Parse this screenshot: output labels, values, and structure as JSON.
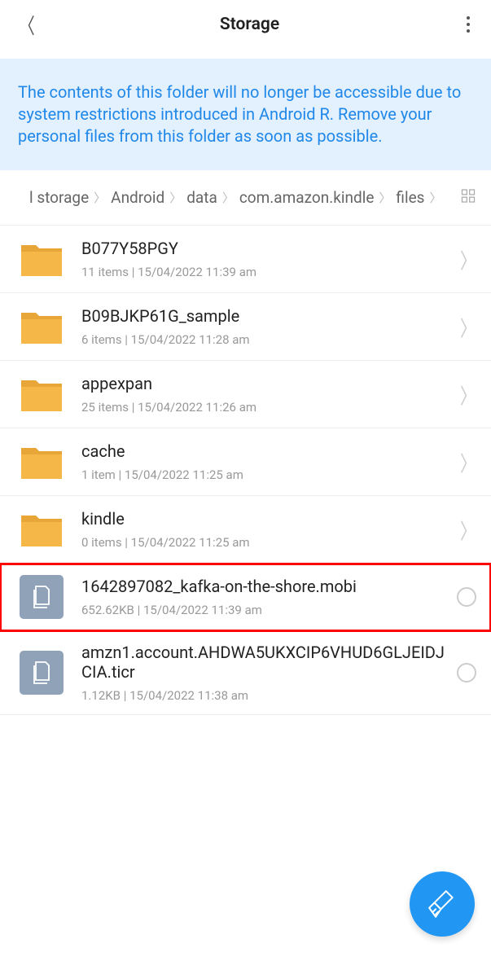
{
  "header": {
    "title": "Storage"
  },
  "banner": {
    "text": "The contents of this folder will no longer be accessible due to system restrictions introduced in Android R. Remove your personal files from this folder as soon as possible."
  },
  "breadcrumb": {
    "items": [
      "l storage",
      "Android",
      "data",
      "com.amazon.kindle",
      "files"
    ]
  },
  "items": [
    {
      "type": "folder",
      "name": "B077Y58PGY",
      "meta": "11 items  |  15/04/2022 11:39 am",
      "action": "chevron"
    },
    {
      "type": "folder",
      "name": "B09BJKP61G_sample",
      "meta": "6 items  |  15/04/2022 11:28 am",
      "action": "chevron"
    },
    {
      "type": "folder",
      "name": "appexpan",
      "meta": "25 items  |  15/04/2022 11:26 am",
      "action": "chevron"
    },
    {
      "type": "folder",
      "name": "cache",
      "meta": "1 item  |  15/04/2022 11:25 am",
      "action": "chevron"
    },
    {
      "type": "folder",
      "name": "kindle",
      "meta": "0 items  |  15/04/2022 11:25 am",
      "action": "chevron"
    },
    {
      "type": "file",
      "name": "1642897082_kafka-on-the-shore.mobi",
      "meta": "652.62KB  |  15/04/2022 11:39 am",
      "action": "radio",
      "highlighted": true
    },
    {
      "type": "file",
      "name": "amzn1.account.AHDWA5UKXCIP6VHUD6GLJEIDJCIA.ticr",
      "meta": "1.12KB  |  15/04/2022 11:38 am",
      "action": "radio"
    }
  ]
}
